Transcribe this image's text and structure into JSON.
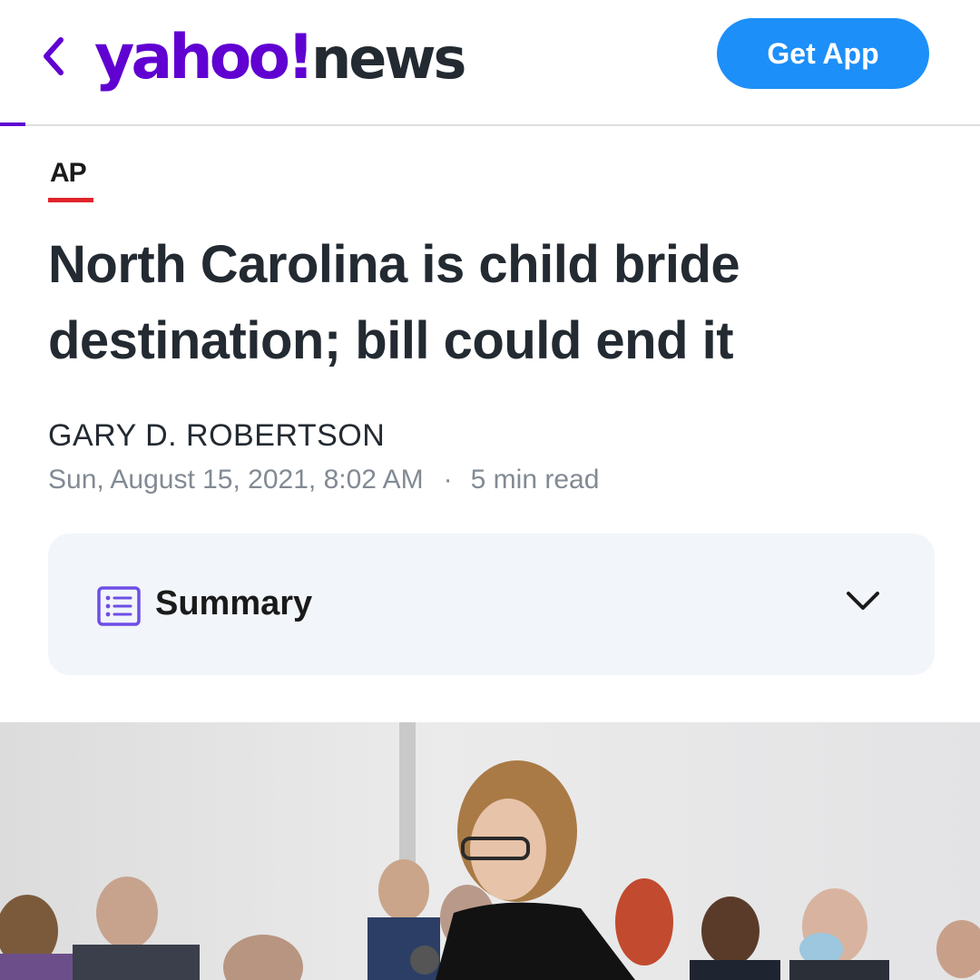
{
  "header": {
    "logo_primary": "yahoo!",
    "logo_secondary": "news",
    "get_app_label": "Get App",
    "brand_color": "#6001d2",
    "button_color": "#1d8ff8"
  },
  "article": {
    "provider": "AP",
    "headline": "North Carolina is child bride destination; bill could end it",
    "author": "GARY D. ROBERTSON",
    "date": "Sun, August 15, 2021, 8:02 AM",
    "separator": "·",
    "read_time": "5 min read"
  },
  "summary": {
    "label": "Summary",
    "icon": "list-icon",
    "toggle_icon": "chevron-down-icon"
  },
  "photo": {
    "icon": "article-photo"
  }
}
